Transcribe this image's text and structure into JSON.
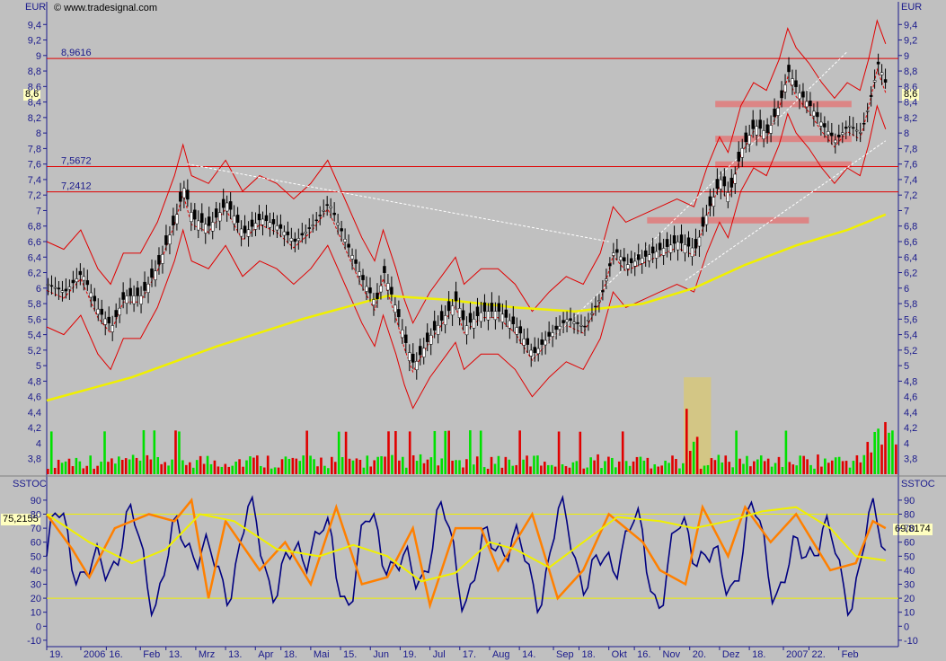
{
  "header": {
    "currency_left": "EUR",
    "currency_right": "EUR",
    "copyright": "© www.tradesignal.com",
    "indicator_left": "SSTOC",
    "indicator_right": "SSTOC"
  },
  "colors": {
    "background": "#c0c0c0",
    "axis_text": "#1a1a8c",
    "resistance_lines": "#e00000",
    "bollinger": "#e00000",
    "sma_long": "#f0f000",
    "volume_up": "#00e000",
    "volume_down": "#e00000",
    "stoch_fast": "#000080",
    "stoch_slow": "#ff8000",
    "stoch_signal": "#f0f000",
    "zone_highlight": "#d6c77a",
    "support_band": "#e07a7a"
  },
  "chart_data": [
    {
      "type": "candlestick",
      "panel": "price",
      "instrument_currency": "EUR",
      "y_ticks": [
        4.8,
        5,
        5.2,
        5.4,
        5.6,
        5.8,
        6,
        6.2,
        6.4,
        6.6,
        6.8,
        7,
        7.2,
        7.4,
        7.6,
        7.8,
        8,
        8.2,
        8.4,
        8.6,
        8.8,
        9,
        9.2,
        9.4
      ],
      "y_tick_labels": [
        "4,8",
        "5",
        "5,2",
        "5,4",
        "5,6",
        "5,8",
        "6",
        "6,2",
        "6,4",
        "6,6",
        "6,8",
        "7",
        "7,2",
        "7,4",
        "7,6",
        "7,8",
        "8",
        "8,2",
        "8,4",
        "8,6",
        "8,8",
        "9",
        "9,2",
        "9,4"
      ],
      "volume_axis_labels": [
        "3,8",
        "4",
        "4,2",
        "4,4",
        "4,6"
      ],
      "ylim": [
        3.6,
        9.6
      ],
      "horizontal_levels": [
        {
          "value": 8.9616,
          "label": "8,9616"
        },
        {
          "value": 7.5672,
          "label": "7,5672"
        },
        {
          "value": 7.2412,
          "label": "7,2412"
        }
      ],
      "last_price": {
        "value": 8.6,
        "label": "8,6"
      },
      "support_zones": [
        {
          "value": 8.38,
          "start": 0.785,
          "end": 0.945
        },
        {
          "value": 7.93,
          "start": 0.785,
          "end": 0.945
        },
        {
          "value": 7.6,
          "start": 0.785,
          "end": 0.945
        },
        {
          "value": 6.88,
          "start": 0.705,
          "end": 0.895
        }
      ],
      "highlight_volume_zone": {
        "start": 0.748,
        "end": 0.78
      },
      "price_series": [
        {
          "x": 0.0,
          "y": 6.05
        },
        {
          "x": 0.02,
          "y": 5.95
        },
        {
          "x": 0.04,
          "y": 6.2
        },
        {
          "x": 0.06,
          "y": 5.7
        },
        {
          "x": 0.075,
          "y": 5.5
        },
        {
          "x": 0.09,
          "y": 5.9
        },
        {
          "x": 0.11,
          "y": 5.9
        },
        {
          "x": 0.13,
          "y": 6.3
        },
        {
          "x": 0.15,
          "y": 6.9
        },
        {
          "x": 0.16,
          "y": 7.3
        },
        {
          "x": 0.17,
          "y": 6.9
        },
        {
          "x": 0.19,
          "y": 6.8
        },
        {
          "x": 0.21,
          "y": 7.1
        },
        {
          "x": 0.23,
          "y": 6.7
        },
        {
          "x": 0.25,
          "y": 6.9
        },
        {
          "x": 0.27,
          "y": 6.8
        },
        {
          "x": 0.29,
          "y": 6.6
        },
        {
          "x": 0.31,
          "y": 6.8
        },
        {
          "x": 0.33,
          "y": 7.1
        },
        {
          "x": 0.35,
          "y": 6.6
        },
        {
          "x": 0.37,
          "y": 6.1
        },
        {
          "x": 0.385,
          "y": 5.8
        },
        {
          "x": 0.395,
          "y": 6.2
        },
        {
          "x": 0.41,
          "y": 5.7
        },
        {
          "x": 0.42,
          "y": 5.3
        },
        {
          "x": 0.43,
          "y": 5.0
        },
        {
          "x": 0.45,
          "y": 5.4
        },
        {
          "x": 0.47,
          "y": 5.7
        },
        {
          "x": 0.48,
          "y": 5.85
        },
        {
          "x": 0.49,
          "y": 5.5
        },
        {
          "x": 0.51,
          "y": 5.7
        },
        {
          "x": 0.53,
          "y": 5.7
        },
        {
          "x": 0.55,
          "y": 5.5
        },
        {
          "x": 0.57,
          "y": 5.15
        },
        {
          "x": 0.59,
          "y": 5.4
        },
        {
          "x": 0.61,
          "y": 5.6
        },
        {
          "x": 0.63,
          "y": 5.5
        },
        {
          "x": 0.65,
          "y": 5.9
        },
        {
          "x": 0.665,
          "y": 6.5
        },
        {
          "x": 0.68,
          "y": 6.3
        },
        {
          "x": 0.7,
          "y": 6.4
        },
        {
          "x": 0.72,
          "y": 6.5
        },
        {
          "x": 0.74,
          "y": 6.6
        },
        {
          "x": 0.76,
          "y": 6.5
        },
        {
          "x": 0.775,
          "y": 7.0
        },
        {
          "x": 0.79,
          "y": 7.4
        },
        {
          "x": 0.8,
          "y": 7.2
        },
        {
          "x": 0.815,
          "y": 7.8
        },
        {
          "x": 0.83,
          "y": 8.1
        },
        {
          "x": 0.845,
          "y": 8.0
        },
        {
          "x": 0.86,
          "y": 8.4
        },
        {
          "x": 0.87,
          "y": 8.8
        },
        {
          "x": 0.88,
          "y": 8.55
        },
        {
          "x": 0.895,
          "y": 8.35
        },
        {
          "x": 0.91,
          "y": 8.1
        },
        {
          "x": 0.925,
          "y": 7.9
        },
        {
          "x": 0.94,
          "y": 8.1
        },
        {
          "x": 0.955,
          "y": 8.0
        },
        {
          "x": 0.965,
          "y": 8.4
        },
        {
          "x": 0.975,
          "y": 8.9
        },
        {
          "x": 0.985,
          "y": 8.6
        }
      ],
      "sma_series": [
        {
          "x": 0.0,
          "y": 4.55
        },
        {
          "x": 0.1,
          "y": 4.85
        },
        {
          "x": 0.2,
          "y": 5.25
        },
        {
          "x": 0.3,
          "y": 5.6
        },
        {
          "x": 0.4,
          "y": 5.9
        },
        {
          "x": 0.47,
          "y": 5.85
        },
        {
          "x": 0.55,
          "y": 5.75
        },
        {
          "x": 0.62,
          "y": 5.7
        },
        {
          "x": 0.7,
          "y": 5.8
        },
        {
          "x": 0.76,
          "y": 6.0
        },
        {
          "x": 0.82,
          "y": 6.3
        },
        {
          "x": 0.88,
          "y": 6.55
        },
        {
          "x": 0.94,
          "y": 6.75
        },
        {
          "x": 0.985,
          "y": 6.95
        }
      ]
    },
    {
      "type": "line",
      "panel": "stochastic",
      "name": "SSTOC",
      "y_ticks": [
        -10,
        0,
        10,
        20,
        30,
        40,
        50,
        60,
        70,
        80,
        90
      ],
      "ylim": [
        -12,
        97
      ],
      "y_tick_labels": [
        "-10",
        "0",
        "10",
        "20",
        "30",
        "40",
        "50",
        "60",
        "70",
        "80",
        "90"
      ],
      "reference_lines": [
        80,
        20
      ],
      "left_value": {
        "value": 75.2155,
        "label": "75,2155"
      },
      "right_value": {
        "value": 69.8174,
        "label": "69,8174"
      },
      "slow_series": [
        {
          "x": 0.0,
          "y": 80
        },
        {
          "x": 0.03,
          "y": 55
        },
        {
          "x": 0.05,
          "y": 35
        },
        {
          "x": 0.08,
          "y": 70
        },
        {
          "x": 0.12,
          "y": 80
        },
        {
          "x": 0.15,
          "y": 75
        },
        {
          "x": 0.17,
          "y": 90
        },
        {
          "x": 0.19,
          "y": 20
        },
        {
          "x": 0.21,
          "y": 75
        },
        {
          "x": 0.25,
          "y": 40
        },
        {
          "x": 0.28,
          "y": 60
        },
        {
          "x": 0.31,
          "y": 30
        },
        {
          "x": 0.34,
          "y": 85
        },
        {
          "x": 0.37,
          "y": 30
        },
        {
          "x": 0.4,
          "y": 35
        },
        {
          "x": 0.43,
          "y": 70
        },
        {
          "x": 0.45,
          "y": 15
        },
        {
          "x": 0.48,
          "y": 70
        },
        {
          "x": 0.51,
          "y": 70
        },
        {
          "x": 0.53,
          "y": 40
        },
        {
          "x": 0.57,
          "y": 80
        },
        {
          "x": 0.6,
          "y": 20
        },
        {
          "x": 0.63,
          "y": 40
        },
        {
          "x": 0.66,
          "y": 80
        },
        {
          "x": 0.7,
          "y": 60
        },
        {
          "x": 0.72,
          "y": 40
        },
        {
          "x": 0.75,
          "y": 30
        },
        {
          "x": 0.77,
          "y": 85
        },
        {
          "x": 0.8,
          "y": 50
        },
        {
          "x": 0.82,
          "y": 85
        },
        {
          "x": 0.85,
          "y": 60
        },
        {
          "x": 0.88,
          "y": 80
        },
        {
          "x": 0.9,
          "y": 60
        },
        {
          "x": 0.92,
          "y": 40
        },
        {
          "x": 0.95,
          "y": 45
        },
        {
          "x": 0.97,
          "y": 75
        },
        {
          "x": 0.985,
          "y": 70
        }
      ],
      "signal_series": [
        {
          "x": 0.0,
          "y": 80
        },
        {
          "x": 0.05,
          "y": 60
        },
        {
          "x": 0.1,
          "y": 45
        },
        {
          "x": 0.14,
          "y": 55
        },
        {
          "x": 0.18,
          "y": 80
        },
        {
          "x": 0.22,
          "y": 75
        },
        {
          "x": 0.27,
          "y": 55
        },
        {
          "x": 0.32,
          "y": 50
        },
        {
          "x": 0.36,
          "y": 58
        },
        {
          "x": 0.4,
          "y": 50
        },
        {
          "x": 0.44,
          "y": 32
        },
        {
          "x": 0.48,
          "y": 38
        },
        {
          "x": 0.52,
          "y": 60
        },
        {
          "x": 0.55,
          "y": 55
        },
        {
          "x": 0.59,
          "y": 42
        },
        {
          "x": 0.63,
          "y": 60
        },
        {
          "x": 0.67,
          "y": 78
        },
        {
          "x": 0.72,
          "y": 75
        },
        {
          "x": 0.76,
          "y": 70
        },
        {
          "x": 0.8,
          "y": 75
        },
        {
          "x": 0.84,
          "y": 82
        },
        {
          "x": 0.88,
          "y": 85
        },
        {
          "x": 0.92,
          "y": 70
        },
        {
          "x": 0.95,
          "y": 50
        },
        {
          "x": 0.985,
          "y": 47
        }
      ]
    }
  ],
  "x_axis": {
    "labels": [
      "19.",
      "2006",
      "16.",
      "Feb",
      "13.",
      "Mrz",
      "13.",
      "Apr",
      "18.",
      "Mai",
      "15.",
      "Jun",
      "19.",
      "Jul",
      "17.",
      "Aug",
      "14.",
      "Sep",
      "18.",
      "Okt",
      "16.",
      "Nov",
      "20.",
      "Dez",
      "18.",
      "2007",
      "22.",
      "Feb"
    ],
    "positions": [
      0.0,
      0.04,
      0.07,
      0.11,
      0.14,
      0.175,
      0.21,
      0.245,
      0.275,
      0.31,
      0.345,
      0.38,
      0.415,
      0.45,
      0.485,
      0.52,
      0.555,
      0.595,
      0.625,
      0.66,
      0.69,
      0.72,
      0.755,
      0.79,
      0.825,
      0.865,
      0.895,
      0.93
    ]
  }
}
